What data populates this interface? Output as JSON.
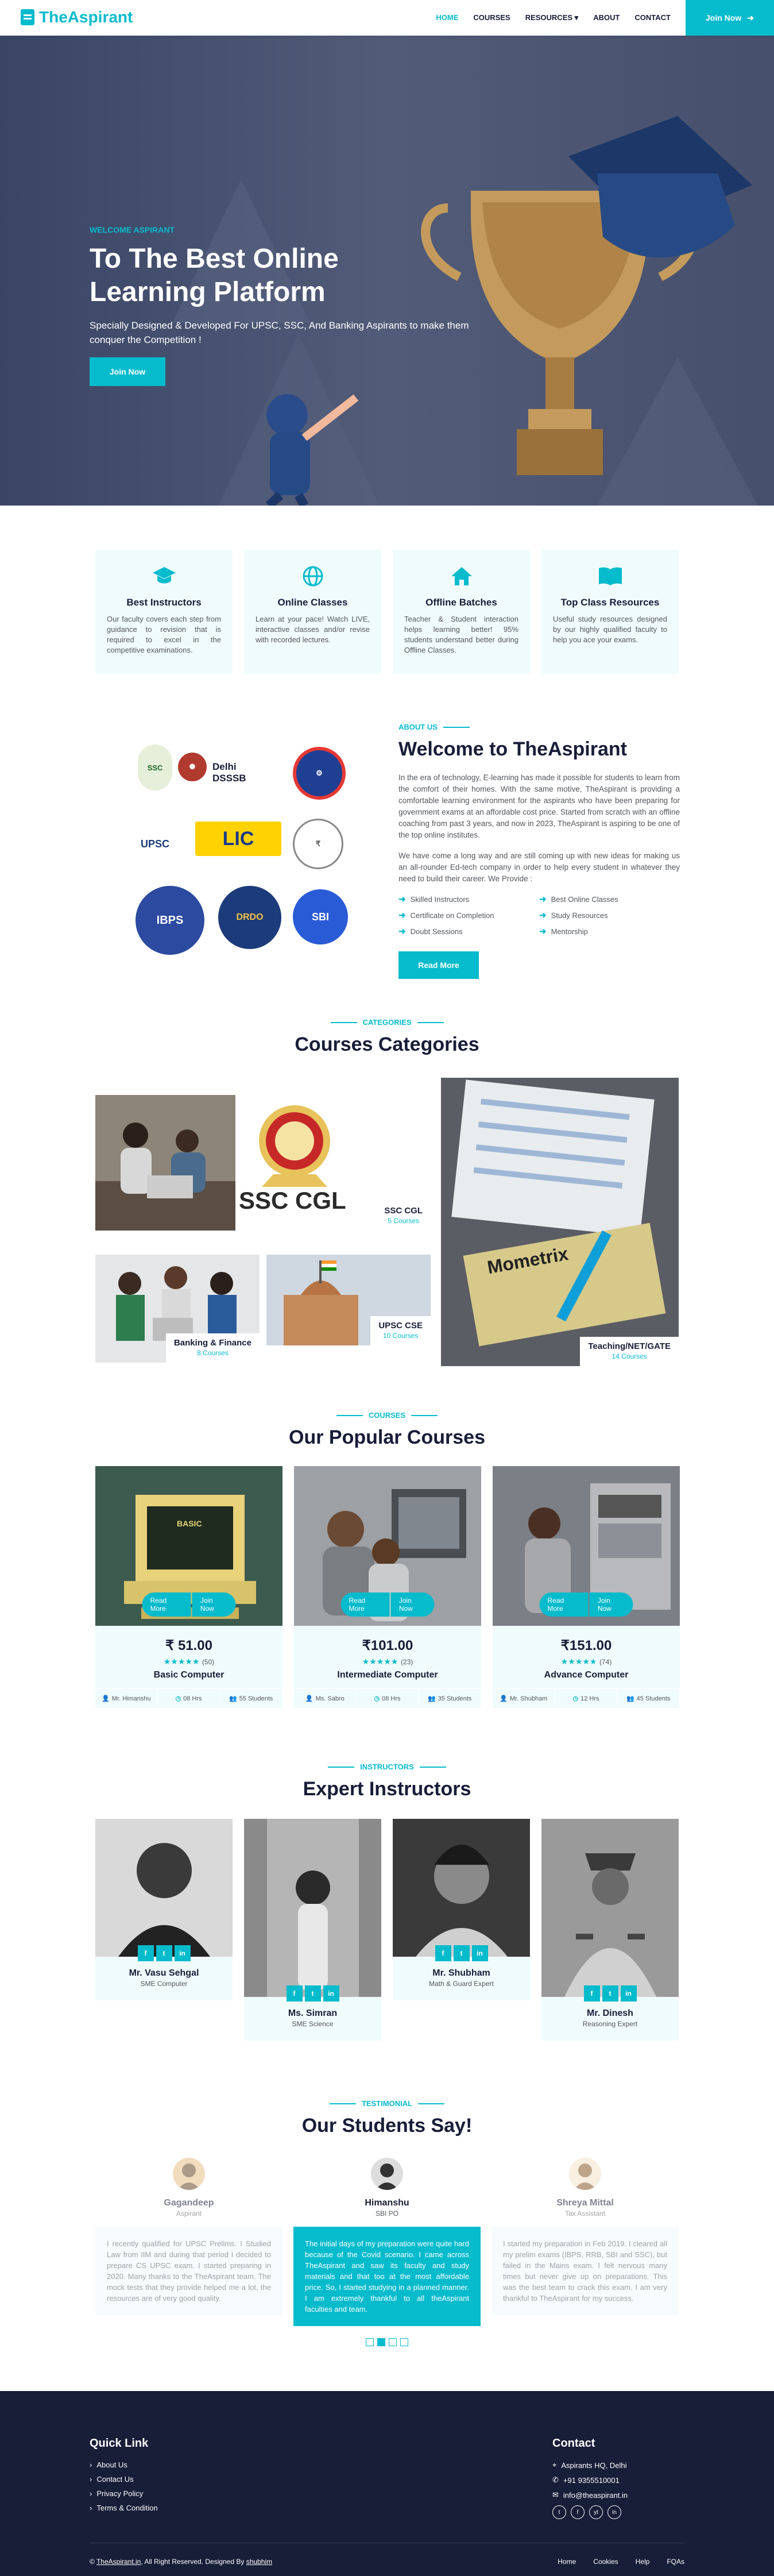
{
  "nav": {
    "brand": "TheAspirant",
    "items": [
      "HOME",
      "COURSES",
      "RESOURCES ▾",
      "ABOUT",
      "CONTACT"
    ],
    "join_label": "Join Now",
    "accent": "#06bbcc",
    "dark": "#181d38"
  },
  "hero": {
    "subtitle": "WELCOME ASPIRANT",
    "title": "To The Best Online Learning Platform",
    "text": "Specially Designed & Developed For UPSC, SSC, And Banking Aspirants to make them conquer the Competition !",
    "button": "Join Now"
  },
  "features": [
    {
      "icon": "graduation-cap-icon",
      "title": "Best Instructors",
      "text": "Our faculty covers each step from guidance to revision that is required to excel in the competitive examinations."
    },
    {
      "icon": "globe-icon",
      "title": "Online Classes",
      "text": "Learn at your pace! Watch LIVE, interactive classes and/or revise with recorded lectures."
    },
    {
      "icon": "home-icon",
      "title": "Offline Batches",
      "text": "Teacher & Student interaction helps learning better! 95% students understand better during Offline Classes."
    },
    {
      "icon": "book-open-icon",
      "title": "Top Class Resources",
      "text": "Useful study resources designed by our highly qualified faculty to help you ace your exams."
    }
  ],
  "logos": [
    "SSC",
    "Delhi DSSSB",
    "UPSC",
    "LIC",
    "IBPS",
    "DRDO",
    "SBI"
  ],
  "about": {
    "subtitle": "ABOUT US",
    "title": "Welcome to TheAspirant",
    "p1": "In the era of technology, E-learning has made it possible for students to learn from the comfort of their homes. With the same motive, TheAspirant is providing a comfortable learning environment for the aspirants who have been preparing for government exams at an affordable cost price. Started from scratch with an offline coaching from past 3 years, and now in 2023, TheAspirant is aspiring to be one of the top online institutes.",
    "p2": "We have come a long way and are still coming up with new ideas for making us an all-rounder Ed-tech company in order to help every student in whatever they need to build their career. We Provide :",
    "list": [
      "Skilled Instructors",
      "Best Online Classes",
      "Certificate on Completion",
      "Study Resources",
      "Doubt Sessions",
      "Mentorship"
    ],
    "button": "Read More"
  },
  "categories": {
    "subtitle": "CATEGORIES",
    "title": "Courses Categories",
    "items": [
      {
        "name": "SSC CGL",
        "count": "5 Courses"
      },
      {
        "name": "Banking & Finance",
        "count": "8 Courses"
      },
      {
        "name": "UPSC CSE",
        "count": "10 Courses"
      },
      {
        "name": "Teaching/NET/GATE",
        "count": "14 Courses"
      }
    ],
    "ssc_text": "SSC CGL",
    "book_text": "Mometrix"
  },
  "courses": {
    "subtitle": "COURSES",
    "title": "Our Popular Courses",
    "read_more": "Read More",
    "join_now": "Join Now",
    "items": [
      {
        "price": "₹ 51.00",
        "stars": "★★★★★",
        "reviews": "(50)",
        "name": "Basic Computer",
        "instructor": "Mr. Himanshu",
        "hours": "08 Hrs",
        "students": "55 Students",
        "screen": "BASIC"
      },
      {
        "price": "₹101.00",
        "stars": "★★★★★",
        "reviews": "(23)",
        "name": "Intermediate Computer",
        "instructor": "Ms. Sabro",
        "hours": "08 Hrs",
        "students": "35 Students"
      },
      {
        "price": "₹151.00",
        "stars": "★★★★★",
        "reviews": "(74)",
        "name": "Advance Computer",
        "instructor": "Mr. Shubham",
        "hours": "12 Hrs",
        "students": "45 Students"
      }
    ]
  },
  "instructors": {
    "subtitle": "INSTRUCTORS",
    "title": "Expert Instructors",
    "items": [
      {
        "name": "Mr. Vasu Sehgal",
        "role": "SME Computer"
      },
      {
        "name": "Ms. Simran",
        "role": "SME Science"
      },
      {
        "name": "Mr. Shubham",
        "role": "Math & Guard Expert"
      },
      {
        "name": "Mr. Dinesh",
        "role": "Reasoning Expert"
      }
    ],
    "social": [
      "f",
      "t",
      "in"
    ]
  },
  "testimonials": {
    "subtitle": "TESTIMONIAL",
    "title": "Our Students Say!",
    "items": [
      {
        "name": "Gagandeep",
        "role": "Aspirant",
        "text": "I recently qualified for UPSC Prelims. I Studied Law from IIM and during that period I decided to prepare CS UPSC exam. I started preparing in 2020. Many thanks to the TheAspirant team. The mock tests that they provide helped me a lot, the resources are of very good quality."
      },
      {
        "name": "Himanshu",
        "role": "SBI PO",
        "text": "The initial days of my preparation were quite hard because of the Covid scenario. I came across TheAspirant and saw its faculty and study materials and that too at the most affordable price. So, I started studying in a planned manner. I am extremely thankful to all theAspirant faculties and team."
      },
      {
        "name": "Shreya Mittal",
        "role": "Tax Assistant",
        "text": "I started my preparation in Feb 2019. I cleared all my prelim exams (IBPS, RRB, SBI and SSC), but failed in the Mains exam. I felt nervous many times but never give up on preparations. This was the best team to crack this exam. I am very thankful to TheAspirant for my success."
      }
    ]
  },
  "footer": {
    "quick_title": "Quick Link",
    "quick_links": [
      "About Us",
      "Contact Us",
      "Privacy Policy",
      "Terms & Condition"
    ],
    "contact_title": "Contact",
    "address": "Aspirants HQ, Delhi",
    "phone": "+91 9355510001",
    "email": "info@theaspirant.in",
    "social": [
      "t",
      "f",
      "yt",
      "in"
    ],
    "copy_site": "TheAspirant.in",
    "copy_text": ", All Right Reserved. Designed By ",
    "copy_author": "shubhim",
    "links": [
      "Home",
      "Cookies",
      "Help",
      "FQAs"
    ]
  }
}
